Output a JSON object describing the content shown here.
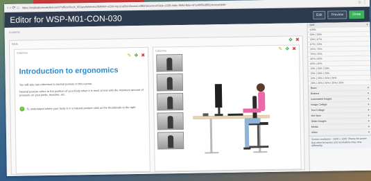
{
  "browser": {
    "nav_glyphs": "‹ › ⟳ ⌂",
    "url": "https://evaluationscardiva.com/?office/Deck_0/Zays/Ieldeckn/2MMAF-eODI-4a1d-a6b4-8eeaa1c38b0a/contentSlide-1928-4ddc-9b9d-fb5e-ef7a4006e8f6/preview/slide",
    "right_glyphs": "☆ ⋮"
  },
  "header": {
    "title": "Editor for WSP-M01-CON-030",
    "buttons": {
      "edit": "Edit",
      "preview": "Preview",
      "done": "Done"
    }
  },
  "workspace": {
    "content_tag": "Contents",
    "slide_tag": "Slide",
    "text_panel": {
      "tag": "Columns",
      "title": "Introduction to ergonomics",
      "para1": "You will also see reference to neutral posture in this course.",
      "para2": "Neutral posture refers to the position of your body when it is most at rest with the minimum amount of pressure on your joints, muscles, etc.",
      "hint": "To understand where your body is in a natural posture click on the thumbnails to the right."
    },
    "image_panel": {
      "tag": "Columns"
    },
    "tools": {
      "edit": "✎",
      "move": "✥",
      "remove": "✖"
    }
  },
  "sidebar": {
    "sizes_head": "Grid",
    "sizes": [
      "100%",
      "50% | 50%",
      "33% | 67%",
      "67% | 33%",
      "25% | 75%",
      "75% | 25%",
      "40% | 60%",
      "60% | 40%",
      "33% | 33% | 33%",
      "25% | 50% | 25%",
      "25% | 25% | 25% | 25%",
      "20% | 20% | 20% | 20% | 20%"
    ],
    "sections": [
      "Basic",
      "Buttons",
      "Automated Images",
      "Image Collage",
      "Text Collage",
      "Hot Spot",
      "Slider Images",
      "Media",
      "Video"
    ],
    "caret": "▾",
    "note": "Screen resolution - 1920 x 1200. Please be aware that other browsers and resolutions may view differently."
  }
}
